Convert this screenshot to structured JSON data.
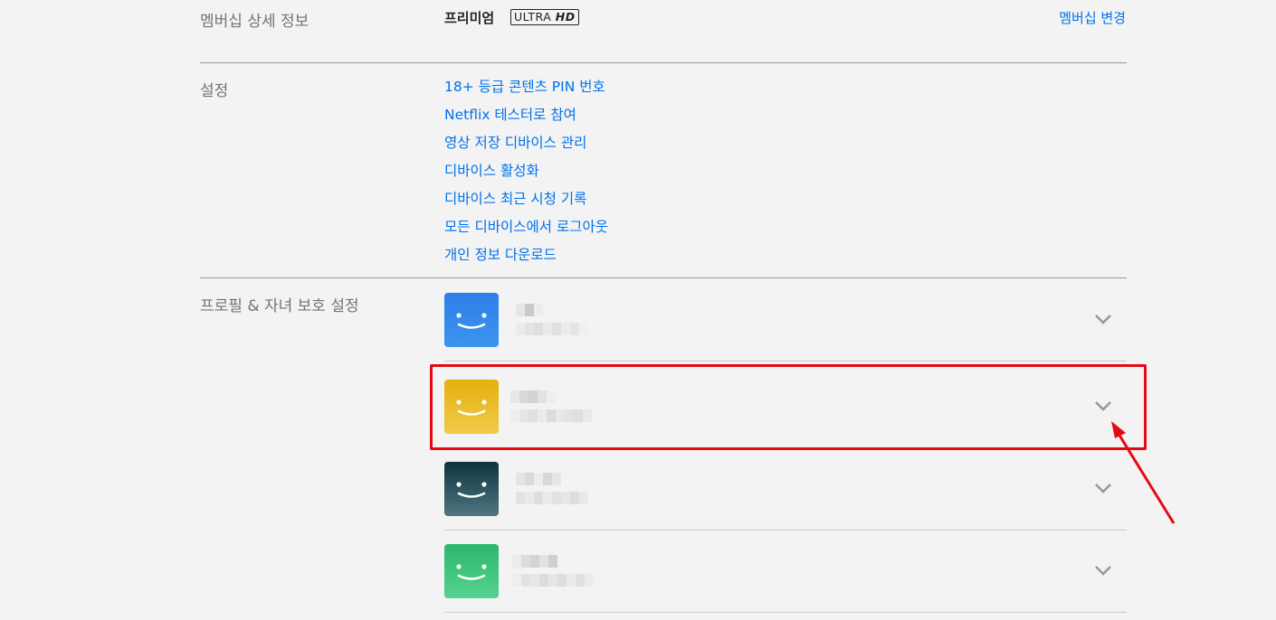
{
  "membership": {
    "label": "멤버십 상세 정보",
    "plan_name": "프리미엄",
    "badge_text": "ULTRA",
    "badge_hd": "HD",
    "change_link": "멤버십 변경"
  },
  "settings": {
    "label": "설정",
    "links": [
      "18+ 등급 콘텐츠 PIN 번호",
      "Netflix 테스터로 참여",
      "영상 저장 디바이스 관리",
      "디바이스 활성화",
      "디바이스 최근 시청 기록",
      "모든 디바이스에서 로그아웃",
      "개인 정보 다운로드"
    ]
  },
  "profiles": {
    "label": "프로필 & 자녀 보호 설정",
    "items": [
      {
        "avatar_color": "#2f7ee6",
        "name_redacted": true,
        "details_redacted": true
      },
      {
        "avatar_color": "#e5b41a",
        "name_redacted": true,
        "details_redacted": true,
        "highlighted": true
      },
      {
        "avatar_color": "#1f4e5e",
        "name_redacted": true,
        "details_redacted": true
      },
      {
        "avatar_color": "#3ac17e",
        "name_redacted": true,
        "details_redacted": true
      }
    ]
  },
  "annotation": {
    "highlight_color": "#e50914"
  }
}
